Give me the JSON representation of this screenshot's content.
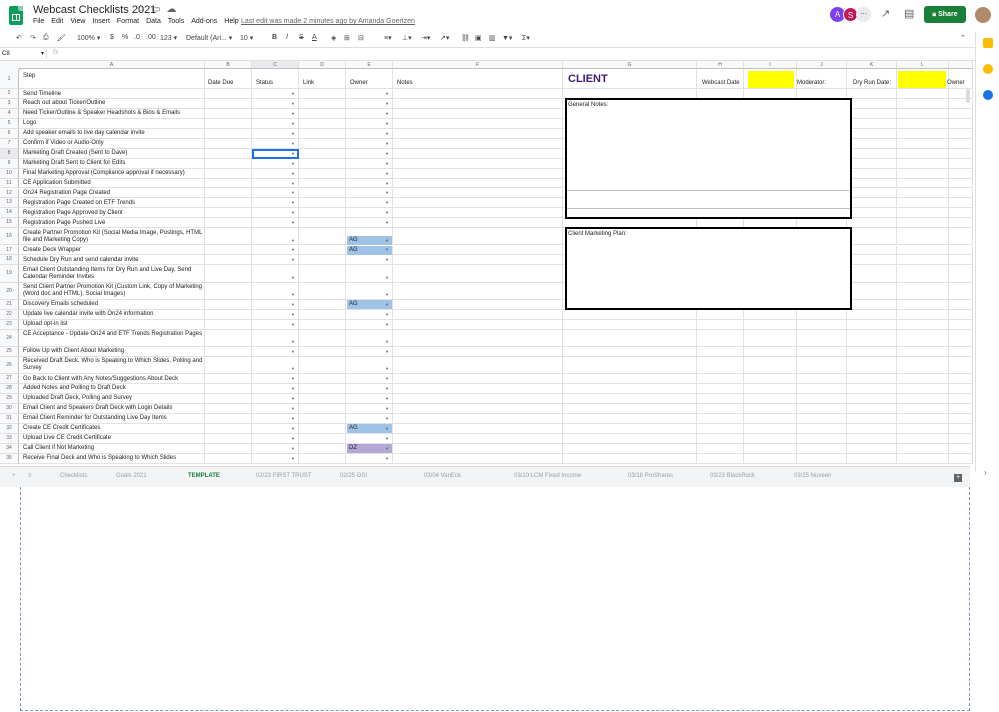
{
  "header": {
    "doc_title": "Webcast Checklists 2021",
    "menu": [
      "File",
      "Edit",
      "View",
      "Insert",
      "Format",
      "Data",
      "Tools",
      "Add-ons",
      "Help"
    ],
    "last_edit": "Last edit was made 2 minutes ago by Amanda Goertzen",
    "avatar_a": "A",
    "avatar_s": "S",
    "share_label": "Share"
  },
  "toolbar": {
    "zoom": "100%",
    "currency": "$",
    "percent": "%",
    "dec_less": ".0",
    "dec_more": ".00",
    "format_more": "123",
    "font": "Default (Ari...",
    "font_size": "10",
    "bold": "B",
    "italic": "I",
    "strike": "S",
    "text_color": "A"
  },
  "formula_bar": {
    "name_box": "C8",
    "fx": "fx"
  },
  "columns": [
    {
      "letter": "A"
    },
    {
      "letter": "B"
    },
    {
      "letter": "C"
    },
    {
      "letter": "D"
    },
    {
      "letter": "E"
    },
    {
      "letter": "F"
    },
    {
      "letter": "G"
    },
    {
      "letter": "H"
    },
    {
      "letter": "I"
    },
    {
      "letter": "J"
    },
    {
      "letter": "K"
    },
    {
      "letter": "L"
    },
    {
      "letter": ""
    }
  ],
  "row1": {
    "step": "Step",
    "date_due": "Date Due",
    "status": "Status",
    "link": "Link",
    "owner": "Owner",
    "notes": "Notes",
    "client": "CLIENT",
    "webcast_date": "Webcast Date",
    "moderator": "Moderator:",
    "dry_run_date": "Dry Run Date:",
    "owner2": "Owner"
  },
  "rows": [
    {
      "n": "2",
      "step": "Send Timeline",
      "owner": ""
    },
    {
      "n": "3",
      "step": "Reach out about Ticker/Outline",
      "owner": ""
    },
    {
      "n": "4",
      "step": "Need Ticker/Outline & Speaker Headshots & Bios & Emails",
      "owner": ""
    },
    {
      "n": "5",
      "step": "Logo",
      "owner": ""
    },
    {
      "n": "6",
      "step": "Add speaker emails to live day calendar invite",
      "owner": ""
    },
    {
      "n": "7",
      "step": "Confirm if Video or Audio-Only",
      "owner": ""
    },
    {
      "n": "8",
      "step": "Marketing Draft Created (Sent to Dave)",
      "owner": ""
    },
    {
      "n": "9",
      "step": "Marketing Draft Sent to Client for Edits",
      "owner": ""
    },
    {
      "n": "10",
      "step": "Final Marketing Approval (Compliance approval if necessary)",
      "owner": ""
    },
    {
      "n": "11",
      "step": "CE Application Submitted",
      "owner": ""
    },
    {
      "n": "12",
      "step": "On24 Registration Page Created",
      "owner": ""
    },
    {
      "n": "13",
      "step": "Registration Page Created on ETF Trends",
      "owner": ""
    },
    {
      "n": "14",
      "step": "Registration Page Approved by Client",
      "owner": ""
    },
    {
      "n": "15",
      "step": "Registration Page Pushed Live",
      "owner": ""
    },
    {
      "n": "16",
      "step": "Create Partner Promotion Kit (Social Media Image, Postings, HTML file and Marketing Copy)",
      "owner": "AG"
    },
    {
      "n": "17",
      "step": "Create Deck Wrapper",
      "owner": "AG"
    },
    {
      "n": "18",
      "step": "Schedule Dry Run and send calendar invite",
      "owner": ""
    },
    {
      "n": "19",
      "step": "Email Client Outstanding Items for Dry Run and Live Day, Send Calendar Reminder Invites",
      "owner": ""
    },
    {
      "n": "20",
      "step": "Send Client Partner Promotion Kit (Custom Link, Copy of Marketing (Word doc and HTML), Social Images)",
      "owner": ""
    },
    {
      "n": "21",
      "step": "Discovery Emails scheduled",
      "owner": "AG"
    },
    {
      "n": "22",
      "step": "Update live calendar invite with On24 information",
      "owner": ""
    },
    {
      "n": "23",
      "step": "Upload opt-in list",
      "owner": ""
    },
    {
      "n": "24",
      "step": "CE Acceptance - Update On24 and ETF Trends Registration Pages",
      "owner": ""
    },
    {
      "n": "25",
      "step": "Follow Up with Client About Marketing",
      "owner": ""
    },
    {
      "n": "26",
      "step": "Received Draft Deck, Who is Speaking to Which Slides, Polling and Survey",
      "owner": ""
    },
    {
      "n": "27",
      "step": "Go Back to Client with Any Notes/Suggestions About Deck",
      "owner": ""
    },
    {
      "n": "28",
      "step": "Added Notes and Polling to Draft Deck",
      "owner": ""
    },
    {
      "n": "29",
      "step": "Uploaded Draft Deck, Polling and Survey",
      "owner": ""
    },
    {
      "n": "30",
      "step": "Email Client and Speakers Draft Deck with Login Details",
      "owner": ""
    },
    {
      "n": "31",
      "step": "Email Client Reminder for Outstanding Live Day Items",
      "owner": ""
    },
    {
      "n": "32",
      "step": "Create CE Credit Certificates",
      "owner": "AG"
    },
    {
      "n": "33",
      "step": "Upload Live CE Credit Certificate",
      "owner": ""
    },
    {
      "n": "34",
      "step": "Call Client if Not Marketing",
      "owner": "DZ"
    },
    {
      "n": "35",
      "step": "Receive Final Deck and Who is Speaking to Which Slides",
      "owner": ""
    }
  ],
  "panels": {
    "general_notes": "General Notes:",
    "client_marketing_plan": "Client Marketing Plan:"
  },
  "tabs": [
    {
      "label": "Checklists"
    },
    {
      "label": "Goals 2021"
    },
    {
      "label": "TEMPLATE"
    },
    {
      "label": "02/23 FIRST TRUST"
    },
    {
      "label": "02/25 OSI"
    },
    {
      "label": "03/04 VanEck"
    },
    {
      "label": "03/10 LCM Fixed Income"
    },
    {
      "label": "03/18 ProShares"
    },
    {
      "label": "03/23 BlackRock"
    },
    {
      "label": "03/25 Nuveen"
    }
  ],
  "colors": {
    "chip_ag": "#9fc3e7",
    "chip_dz": "#b4a7d6",
    "yellow": "#ffff00",
    "client": "#3d1a78",
    "share": "#188038"
  }
}
